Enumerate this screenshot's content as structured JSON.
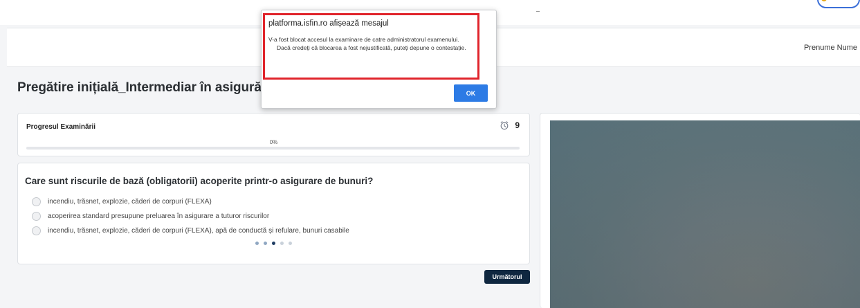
{
  "dialog": {
    "title": "platforma.isfin.ro afișează mesajul",
    "message_line1": "V-a fost blocat accesul la examinare de catre administratorul examenului.",
    "message_line2": "Dacă credeți că blocarea a fost nejustificată, puteți depune o contestație.",
    "ok_label": "OK",
    "highlight_color": "#e0242b"
  },
  "header": {
    "user_name": "Prenume Nume"
  },
  "page": {
    "title": "Pregătire inițială_Intermediar în asigurări"
  },
  "progress": {
    "title": "Progresul Examinării",
    "percent_label": "0%",
    "percent_value": 0,
    "timer_icon": "alarm-clock-icon",
    "timer_value": "9"
  },
  "question": {
    "text": "Care sunt riscurile de bază (obligatorii) acoperite printr-o asigurare de bunuri?",
    "options": [
      "incendiu, trăsnet, explozie, căderi de corpuri (FLEXA)",
      "acoperirea standard presupune preluarea în asigurare a tuturor riscurilor",
      "incendiu, trăsnet, explozie, căderi de corpuri (FLEXA), apă de conductă și refulare, bunuri casabile"
    ],
    "pagination": {
      "total": 5,
      "current": 3
    }
  },
  "navigation": {
    "next_label": "Următorul"
  },
  "colors": {
    "primary_button": "#0f2740",
    "dialog_button": "#2d7be5",
    "progress_fill": "#2b7be4"
  }
}
